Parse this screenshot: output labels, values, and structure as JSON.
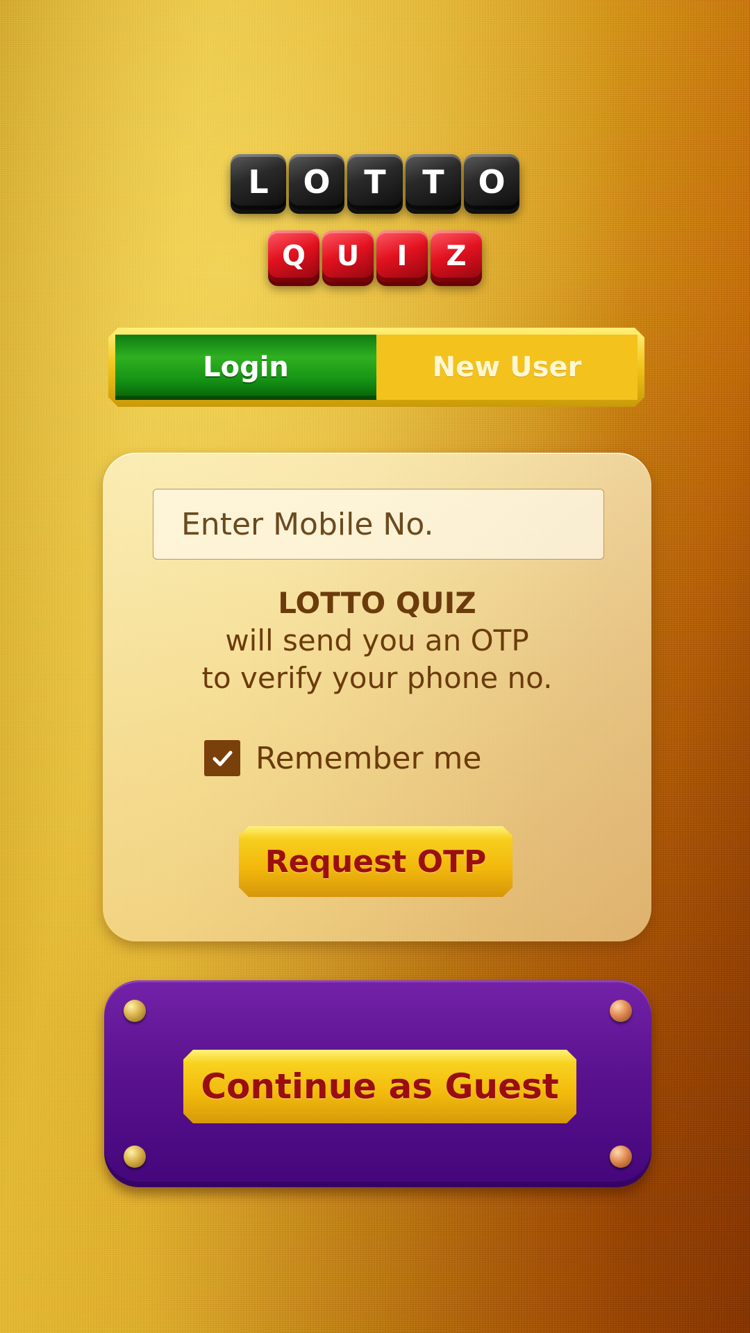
{
  "logo": {
    "top_word": [
      "L",
      "O",
      "T",
      "T",
      "O"
    ],
    "bottom_word": [
      "Q",
      "U",
      "I",
      "Z"
    ]
  },
  "tabs": [
    {
      "label": "Login",
      "active": true
    },
    {
      "label": "New User",
      "active": false
    }
  ],
  "login_form": {
    "mobile_placeholder": "Enter Mobile No.",
    "mobile_value": "",
    "otp_info": {
      "title": "LOTTO QUIZ",
      "line1": "will send you an OTP",
      "line2": "to verify your phone no."
    },
    "remember_me": {
      "label": "Remember me",
      "checked": true,
      "icon": "checkmark-icon"
    },
    "request_otp_label": "Request OTP"
  },
  "guest": {
    "button_label": "Continue as Guest"
  },
  "colors": {
    "active_tab": "#2fb021",
    "inactive_tab": "#f4c21c",
    "button_gold": "#f2b80c",
    "button_text": "#9c0f10",
    "guest_panel": "#5a128f",
    "card_text": "#6b3b0c"
  }
}
